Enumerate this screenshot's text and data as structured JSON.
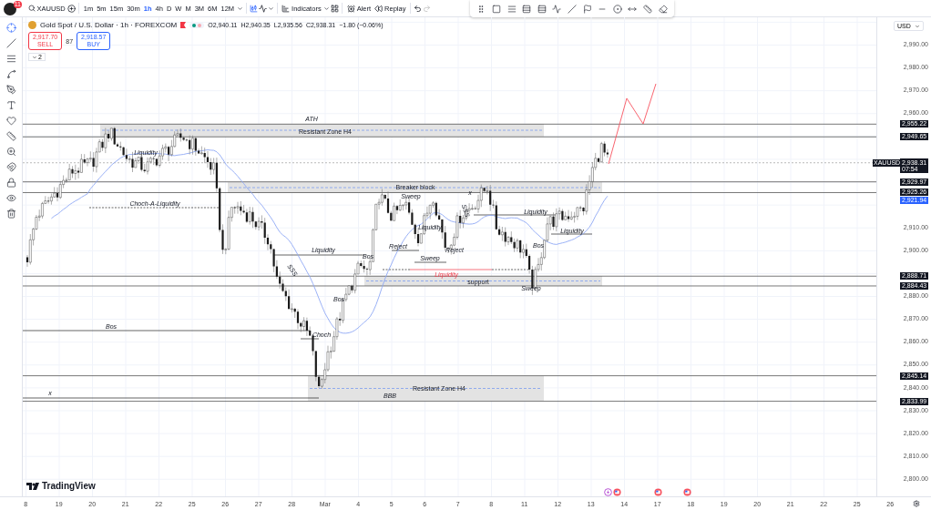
{
  "top_toolbar": {
    "notification_count": "11",
    "symbol": "XAUUSD",
    "intervals": [
      {
        "label": "1m",
        "selected": false
      },
      {
        "label": "5m",
        "selected": false
      },
      {
        "label": "15m",
        "selected": false
      },
      {
        "label": "30m",
        "selected": false
      },
      {
        "label": "1h",
        "selected": true
      },
      {
        "label": "4h",
        "selected": false
      },
      {
        "label": "D",
        "selected": false
      },
      {
        "label": "W",
        "selected": false
      },
      {
        "label": "M",
        "selected": false
      },
      {
        "label": "3M",
        "selected": false
      },
      {
        "label": "6M",
        "selected": false
      },
      {
        "label": "12M",
        "selected": false
      }
    ],
    "indicators": "Indicators",
    "alert": "Alert",
    "replay": "Replay"
  },
  "legend": {
    "title": "Gold Spot / U.S. Dollar · 1h · FOREXCOM",
    "open": "O2,940.11",
    "high": "H2,940.35",
    "low": "L2,935.56",
    "close": "C2,938.31",
    "change": "−1.80 (−0.06%)"
  },
  "trade": {
    "sell_price": "2,917.70",
    "sell_label": "SELL",
    "spread": "87",
    "buy_price": "2,918.57",
    "buy_label": "BUY"
  },
  "indicators_toggle": "2",
  "price_axis": {
    "currency": "USD",
    "ticks": [
      "2,990.00",
      "2,980.00",
      "2,970.00",
      "2,960.00",
      "2,910.00",
      "2,900.00",
      "2,880.00",
      "2,870.00",
      "2,860.00",
      "2,850.00",
      "2,840.00",
      "2,830.00",
      "2,820.00",
      "2,810.00",
      "2,800.00"
    ]
  },
  "levels": [
    "2,955.22",
    "2,949.65",
    "2,929.97",
    "2,925.26",
    "2,888.71",
    "2,884.43",
    "2,845.14",
    "2,833.99"
  ],
  "current_price": {
    "symbol": "XAUUSD",
    "price": "2,938.31",
    "countdown": "07:54"
  },
  "average_price": "2,921.94",
  "annotations": [
    {
      "text": "ATH",
      "kind": "italic"
    },
    {
      "text": "Resistant Zone H4",
      "kind": "plain"
    },
    {
      "text": "Liquidity",
      "kind": "italic"
    },
    {
      "text": "Choch-A-Liquidity",
      "kind": "italic"
    },
    {
      "text": "Breaker block",
      "kind": "plain"
    },
    {
      "text": "Sweep",
      "kind": "italic"
    },
    {
      "text": "x",
      "kind": "italic"
    },
    {
      "text": "SSS",
      "kind": "rotated"
    },
    {
      "text": "Liquidity",
      "kind": "italic"
    },
    {
      "text": "Liquidity",
      "kind": "italic"
    },
    {
      "text": "Liquidity",
      "kind": "italic"
    },
    {
      "text": "Reject",
      "kind": "italic"
    },
    {
      "text": "Reject",
      "kind": "italic"
    },
    {
      "text": "Liquidity",
      "kind": "italic"
    },
    {
      "text": "Bos",
      "kind": "italic"
    },
    {
      "text": "Sweep",
      "kind": "italic"
    },
    {
      "text": "Bos",
      "kind": "italic"
    },
    {
      "text": "SSS",
      "kind": "rotated"
    },
    {
      "text": "Liquidity",
      "kind": "red"
    },
    {
      "text": "support",
      "kind": "plain"
    },
    {
      "text": "Sweep",
      "kind": "italic"
    },
    {
      "text": "Bos",
      "kind": "italic"
    },
    {
      "text": "Bos",
      "kind": "italic"
    },
    {
      "text": "Choch",
      "kind": "italic"
    },
    {
      "text": "Resistant Zone H4",
      "kind": "plain"
    },
    {
      "text": "x",
      "kind": "italic"
    },
    {
      "text": "BBB",
      "kind": "italic"
    }
  ],
  "brand": "TradingView",
  "time_axis": [
    "8",
    "19",
    "20",
    "21",
    "22",
    "25",
    "26",
    "27",
    "28",
    "Mar",
    "4",
    "5",
    "6",
    "7",
    "8",
    "11",
    "12",
    "13",
    "14",
    "17",
    "18",
    "19",
    "20",
    "21",
    "22",
    "25",
    "26"
  ]
}
